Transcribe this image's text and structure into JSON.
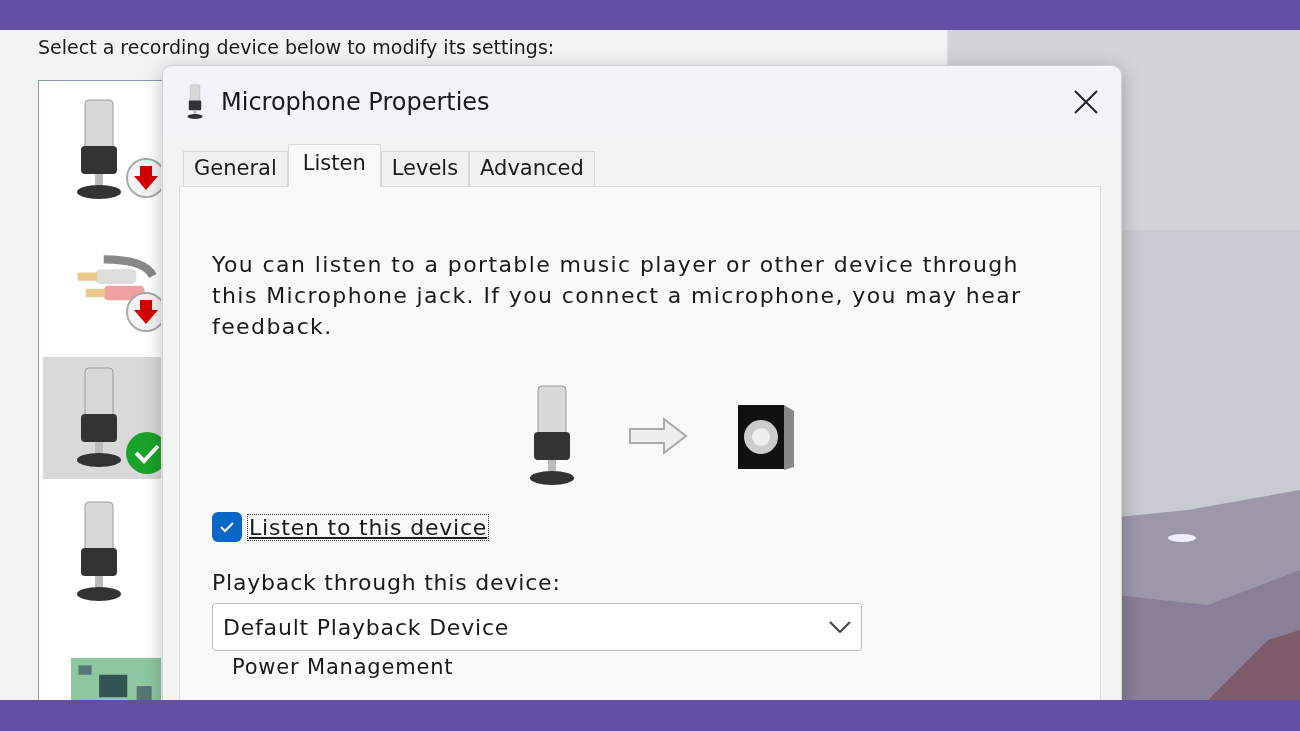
{
  "background_window": {
    "instruction": "Select a recording device below to modify its settings:",
    "devices": [
      {
        "kind": "microphone",
        "disconnected": true,
        "default": false,
        "selected": false
      },
      {
        "kind": "line-in",
        "disconnected": true,
        "default": false,
        "selected": false
      },
      {
        "kind": "microphone",
        "disconnected": false,
        "default": true,
        "selected": true
      },
      {
        "kind": "microphone",
        "disconnected": false,
        "default": false,
        "selected": false
      },
      {
        "kind": "board",
        "disconnected": false,
        "default": false,
        "selected": false
      }
    ]
  },
  "dialog": {
    "title": "Microphone Properties",
    "tabs": [
      {
        "label": "General",
        "selected": false
      },
      {
        "label": "Listen",
        "selected": true
      },
      {
        "label": "Levels",
        "selected": false
      },
      {
        "label": "Advanced",
        "selected": false
      }
    ],
    "description": "You can listen to a portable music player or other device through this Microphone jack.  If you connect a microphone, you may hear feedback.",
    "listen_checkbox": {
      "label": "Listen to this device",
      "checked": true
    },
    "playback_label": "Playback through this device:",
    "playback_select": {
      "value": "Default Playback Device"
    },
    "power_heading": "Power Management"
  }
}
